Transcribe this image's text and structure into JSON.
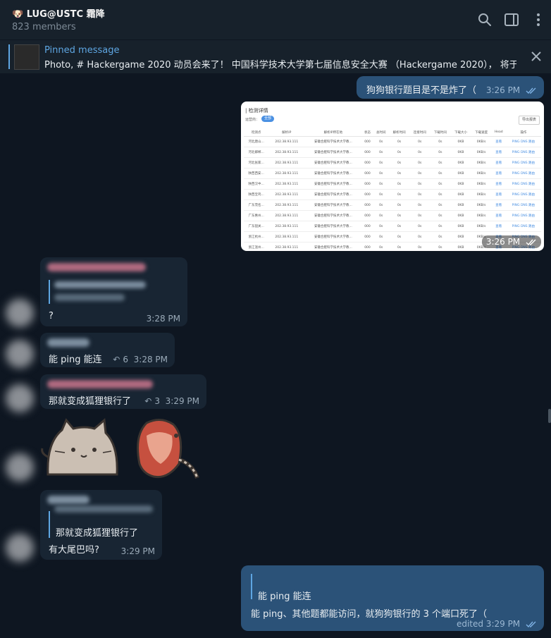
{
  "header": {
    "title": "🐶 LUG@USTC 霜降",
    "members": "823 members",
    "icons": [
      "search-icon",
      "sidebar-icon",
      "more-icon"
    ]
  },
  "pinned": {
    "title": "Pinned message",
    "text": "Photo, # Hackergame 2020 动员会来了！ 中国科学技术大学第七届信息安全大赛 （Hackergame 2020）， 将于..."
  },
  "messages": {
    "m1": {
      "text": "狗狗银行题目是不是炸了（",
      "time": "3:26 PM"
    },
    "m2": {
      "time": "3:26 PM"
    },
    "m3": {
      "text": "?",
      "time": "3:28 PM"
    },
    "m4": {
      "text": "能 ping 能连",
      "replies": "6",
      "time": "3:28 PM"
    },
    "m5": {
      "text": "那就变成狐狸银行了",
      "replies": "3",
      "time": "3:29 PM"
    },
    "m6": {
      "quote": "那就变成狐狸银行了",
      "text": "有大尾巴吗?",
      "time": "3:29 PM"
    },
    "m7": {
      "quote": "能 ping 能连",
      "text": "能 ping、其他题都能访问，就狗狗银行的 3 个端口死了（",
      "time": "edited 3:29 PM"
    }
  },
  "screenshot": {
    "title": "| 检测详情",
    "filter_label": "运营商：",
    "filter_pill": "全部",
    "export_button": "导出报表",
    "headers": [
      "检测点",
      "解析IP",
      "解析IP所在地",
      "状态",
      "总时间",
      "解析时间",
      "连接时间",
      "下载时间",
      "下载大小",
      "下载速度",
      "Head",
      "操作"
    ],
    "rows": [
      [
        "河北唐山...",
        "202.38.93.111",
        "安徽合肥科学技术大学教...",
        "000",
        "0s",
        "0s",
        "0s",
        "0s",
        "0KB",
        "0KB/s",
        "查看",
        "PING DNS 路由"
      ],
      [
        "河北邯郸...",
        "202.38.93.111",
        "安徽合肥科学技术大学教...",
        "000",
        "0s",
        "0s",
        "0s",
        "0s",
        "0KB",
        "0KB/s",
        "查看",
        "PING DNS 路由"
      ],
      [
        "河北张家...",
        "202.38.93.111",
        "安徽合肥科学技术大学教...",
        "000",
        "0s",
        "0s",
        "0s",
        "0s",
        "0KB",
        "0KB/s",
        "查看",
        "PING DNS 路由"
      ],
      [
        "陕西西安...",
        "202.38.93.111",
        "安徽合肥科学技术大学教...",
        "000",
        "0s",
        "0s",
        "0s",
        "0s",
        "0KB",
        "0KB/s",
        "查看",
        "PING DNS 路由"
      ],
      [
        "陕西汉中...",
        "202.38.93.111",
        "安徽合肥科学技术大学教...",
        "000",
        "0s",
        "0s",
        "0s",
        "0s",
        "0KB",
        "0KB/s",
        "查看",
        "PING DNS 路由"
      ],
      [
        "陕西宝鸡...",
        "202.38.93.111",
        "安徽合肥科学技术大学教...",
        "000",
        "0s",
        "0s",
        "0s",
        "0s",
        "0KB",
        "0KB/s",
        "查看",
        "PING DNS 路由"
      ],
      [
        "广东茂名...",
        "202.38.93.111",
        "安徽合肥科学技术大学教...",
        "000",
        "0s",
        "0s",
        "0s",
        "0s",
        "0KB",
        "0KB/s",
        "查看",
        "PING DNS 路由"
      ],
      [
        "广东惠州...",
        "202.38.93.111",
        "安徽合肥科学技术大学教...",
        "000",
        "0s",
        "0s",
        "0s",
        "0s",
        "0KB",
        "0KB/s",
        "查看",
        "PING DNS 路由"
      ],
      [
        "广东韶关...",
        "202.38.93.111",
        "安徽合肥科学技术大学教...",
        "000",
        "0s",
        "0s",
        "0s",
        "0s",
        "0KB",
        "0KB/s",
        "查看",
        "PING DNS 路由"
      ],
      [
        "浙江杭州...",
        "202.38.93.111",
        "安徽合肥科学技术大学教...",
        "000",
        "0s",
        "0s",
        "0s",
        "0s",
        "0KB",
        "0KB/s",
        "查看",
        "PING DNS 路由"
      ],
      [
        "浙江温州...",
        "202.38.93.111",
        "安徽合肥科学技术大学教...",
        "000",
        "0s",
        "0s",
        "0s",
        "0s",
        "0KB",
        "0KB/s",
        "查看",
        "PING DNS 路由"
      ]
    ]
  },
  "colors": {
    "background": "#0e1621",
    "header": "#17212b",
    "outgoing": "#2b5278",
    "incoming": "#182533",
    "accent": "#5ea6e2"
  }
}
